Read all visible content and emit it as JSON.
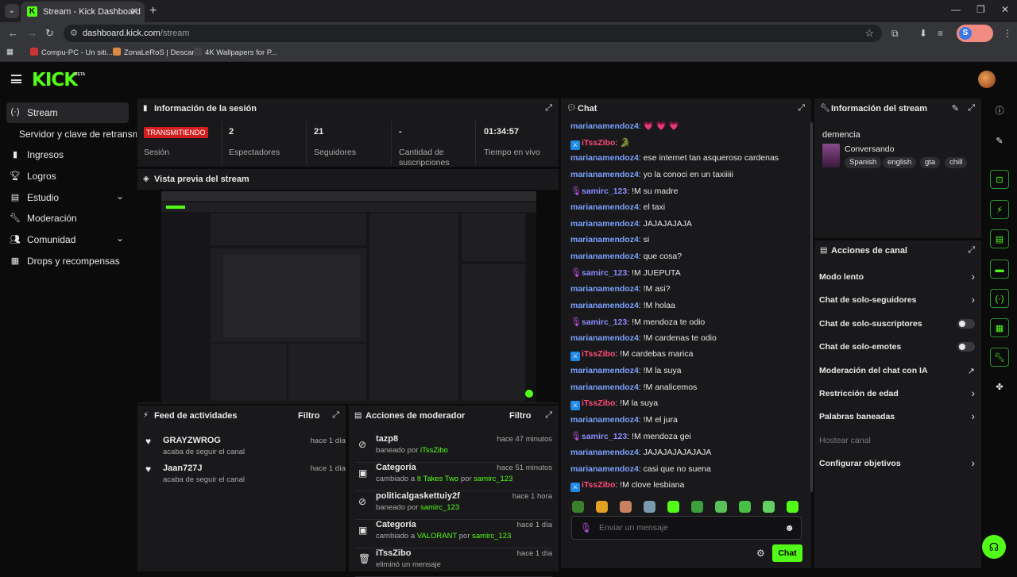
{
  "browser": {
    "tab_title": "Stream - Kick Dashboard",
    "url_host": "dashboard.kick.com",
    "url_path": "/stream",
    "bookmarks": [
      "Compu-PC - Un siti...",
      "ZonaLeRoS | Descar...",
      "4K Wallpapers for P..."
    ],
    "profile_initial": "S"
  },
  "header": {
    "logo": "KICK",
    "logo_badge": "BETA"
  },
  "sidebar": {
    "items": [
      {
        "label": "Stream"
      },
      {
        "label": "Servidor y clave de retransmisión"
      },
      {
        "label": "Ingresos"
      },
      {
        "label": "Logros"
      },
      {
        "label": "Estudio"
      },
      {
        "label": "Moderación"
      },
      {
        "label": "Comunidad"
      },
      {
        "label": "Drops y recompensas"
      }
    ]
  },
  "session": {
    "title": "Información de la sesión",
    "stats": [
      {
        "value": "TRANSMITIENDO",
        "label": "Sesión"
      },
      {
        "value": "2",
        "label": "Espectadores"
      },
      {
        "value": "21",
        "label": "Seguidores"
      },
      {
        "value": "-",
        "label": "Cantidad de suscripciones"
      },
      {
        "value": "01:34:57",
        "label": "Tiempo en vivo"
      }
    ]
  },
  "preview": {
    "title": "Vista previa del stream"
  },
  "feed": {
    "title": "Feed de actividades",
    "filter": "Filtro",
    "items": [
      {
        "name": "GRAYZWROG",
        "sub": "acaba de seguir el canal",
        "time": "hace 1 día"
      },
      {
        "name": "Jaan727J",
        "sub": "acaba de seguir el canal",
        "time": "hace 1 día"
      }
    ]
  },
  "mod": {
    "title": "Acciones de moderador",
    "filter": "Filtro",
    "items": [
      {
        "name": "tazp8",
        "sub_a": "baneado por ",
        "sub_g": "iTssZibo",
        "sub_b": "",
        "sub_g2": "",
        "time": "hace 47 minutos"
      },
      {
        "name": "Categoría",
        "sub_a": "cambiado a ",
        "sub_g": "It Takes Two",
        "sub_b": " por ",
        "sub_g2": "samirc_123",
        "time": "hace 51 minutos"
      },
      {
        "name": "politicalgaskettuiy2f",
        "sub_a": "baneado por ",
        "sub_g": "samirc_123",
        "sub_b": "",
        "sub_g2": "",
        "time": "hace 1 hora"
      },
      {
        "name": "Categoría",
        "sub_a": "cambiado a ",
        "sub_g": "VALORANT",
        "sub_b": " por ",
        "sub_g2": "samirc_123",
        "time": "hace 1 día"
      },
      {
        "name": "iTssZibo",
        "sub_a": "eliminó un mensaje",
        "sub_g": "",
        "sub_b": "",
        "sub_g2": "",
        "time": "hace 1 día"
      }
    ]
  },
  "chat": {
    "title": "Chat",
    "messages": [
      {
        "user": "marianamendoz4",
        "text": ": 💗 💗 💗",
        "badge": "none"
      },
      {
        "user": "iTssZibo",
        "text": ": 🐊",
        "badge": "blue"
      },
      {
        "user": "marianamendoz4",
        "text": ": ese internet tan asqueroso cardenas",
        "badge": "none"
      },
      {
        "user": "marianamendoz4",
        "text": ": yo la conoci en un taxiiiii",
        "badge": "none"
      },
      {
        "user": "samirc_123",
        "text": ": !M su madre",
        "badge": "mic"
      },
      {
        "user": "marianamendoz4",
        "text": ": el taxi",
        "badge": "none"
      },
      {
        "user": "marianamendoz4",
        "text": ": JAJAJAJAJA",
        "badge": "none"
      },
      {
        "user": "marianamendoz4",
        "text": ": si",
        "badge": "none"
      },
      {
        "user": "marianamendoz4",
        "text": ": que cosa?",
        "badge": "none"
      },
      {
        "user": "samirc_123",
        "text": ": !M JUEPUTA",
        "badge": "mic"
      },
      {
        "user": "marianamendoz4",
        "text": ": !M asi?",
        "badge": "none"
      },
      {
        "user": "marianamendoz4",
        "text": ": !M holaa",
        "badge": "none"
      },
      {
        "user": "samirc_123",
        "text": ": !M mendoza te odio",
        "badge": "mic"
      },
      {
        "user": "marianamendoz4",
        "text": ": !M cardenas te odio",
        "badge": "none"
      },
      {
        "user": "iTssZibo",
        "text": ": !M cardebas marica",
        "badge": "blue"
      },
      {
        "user": "marianamendoz4",
        "text": ": !M la suya",
        "badge": "none"
      },
      {
        "user": "marianamendoz4",
        "text": ": !M analicemos",
        "badge": "none"
      },
      {
        "user": "iTssZibo",
        "text": ": !M la suya",
        "badge": "blue"
      },
      {
        "user": "marianamendoz4",
        "text": ": !M el jura",
        "badge": "none"
      },
      {
        "user": "samirc_123",
        "text": ": !M mendoza gei",
        "badge": "mic"
      },
      {
        "user": "marianamendoz4",
        "text": ": JAJAJAJAJAJAJA",
        "badge": "none"
      },
      {
        "user": "marianamendoz4",
        "text": ": casi que no suena",
        "badge": "none"
      },
      {
        "user": "iTssZibo",
        "text": ": !M clove lesbiana",
        "badge": "blue"
      }
    ],
    "input_placeholder": "Enviar un mensaje",
    "send_label": "Chat"
  },
  "stream_info": {
    "title": "Información del stream",
    "stream_title": "demencia",
    "category": "Conversando",
    "tags": [
      "Spanish",
      "english",
      "gta",
      "chill"
    ]
  },
  "channel_actions": {
    "title": "Acciones de canal",
    "items": [
      {
        "label": "Modo lento",
        "control": "chevron"
      },
      {
        "label": "Chat de solo-seguidores",
        "control": "chevron"
      },
      {
        "label": "Chat de solo-suscriptores",
        "control": "toggle"
      },
      {
        "label": "Chat de solo-emotes",
        "control": "toggle"
      },
      {
        "label": "Moderación del chat con IA",
        "control": "external"
      },
      {
        "label": "Restricción de edad",
        "control": "chevron"
      },
      {
        "label": "Palabras baneadas",
        "control": "chevron"
      },
      {
        "label": "Hostear canal",
        "control": "none"
      },
      {
        "label": "Configurar objetivos",
        "control": "chevron"
      }
    ]
  },
  "colors": {
    "accent": "#53fc18",
    "live": "#d21e1e",
    "panel": "#19191b",
    "username": "#7aa2ff"
  }
}
